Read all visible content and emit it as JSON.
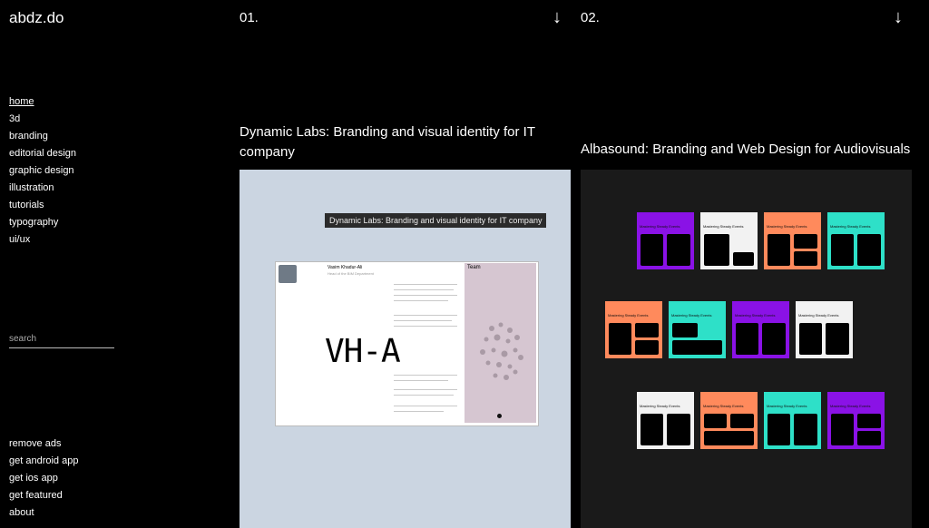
{
  "site": {
    "logo": "abdz.do"
  },
  "nav": {
    "items": [
      "home",
      "3d",
      "branding",
      "editorial design",
      "graphic design",
      "illustration",
      "tutorials",
      "typography",
      "ui/ux"
    ],
    "active": "home"
  },
  "search": {
    "placeholder": "search"
  },
  "footer": {
    "links": [
      "remove ads",
      "get android app",
      "get ios app",
      "get featured",
      "about"
    ]
  },
  "arrow_icon": "↓",
  "projects": [
    {
      "number": "01.",
      "title": "Dynamic Labs: Branding and visual identity for IT company",
      "tooltip": "Dynamic Labs: Branding and visual identity for IT company",
      "preview": {
        "name": "Vasim Khadur-Ali",
        "role": "Head of the BIM Department",
        "big_text": "VH-A",
        "team_title": "Team"
      },
      "bg_color": "#cbd5e1"
    },
    {
      "number": "02.",
      "title": "Albasound: Branding and Web Design for Audiovisuals",
      "bg_color": "#1a1a1a",
      "tile_text": "Mastering Steady Events",
      "tile_colors": [
        "#8a12e6",
        "#f2f2f2",
        "#ff8a5c",
        "#2ee0c8"
      ]
    }
  ]
}
